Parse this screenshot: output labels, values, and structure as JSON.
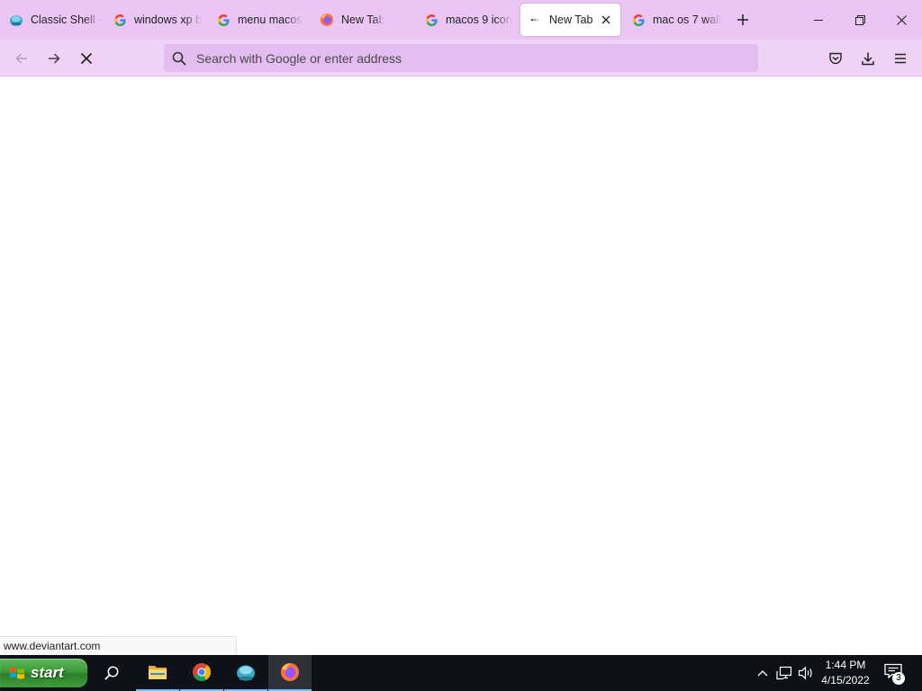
{
  "browser": {
    "tabs": [
      {
        "title": "Classic Shell - ",
        "icon": "classic-shell-icon"
      },
      {
        "title": "windows xp b",
        "icon": "google-icon"
      },
      {
        "title": "menu macos",
        "icon": "google-icon"
      },
      {
        "title": "New Tab",
        "icon": "firefox-icon"
      },
      {
        "title": "macos 9 icon",
        "icon": "google-icon"
      },
      {
        "title": "New Tab",
        "icon": "loading-icon",
        "active": true
      },
      {
        "title": "mac os 7 wall",
        "icon": "google-icon"
      }
    ],
    "url_placeholder": "Search with Google or enter address",
    "status_text": "www.deviantart.com"
  },
  "taskbar": {
    "start_label": "start",
    "apps": [
      "search-icon",
      "file-explorer-icon",
      "chrome-icon",
      "classic-shell-icon",
      "firefox-icon"
    ],
    "clock_time": "1:44 PM",
    "clock_date": "4/15/2022",
    "notification_count": "3"
  },
  "colors": {
    "tab_strip": "#ebc5f4",
    "nav_bar": "#f0d2f7",
    "url_field": "#e3bdf0",
    "taskbar": "#0e1117",
    "start_green": "#3c9a37"
  }
}
